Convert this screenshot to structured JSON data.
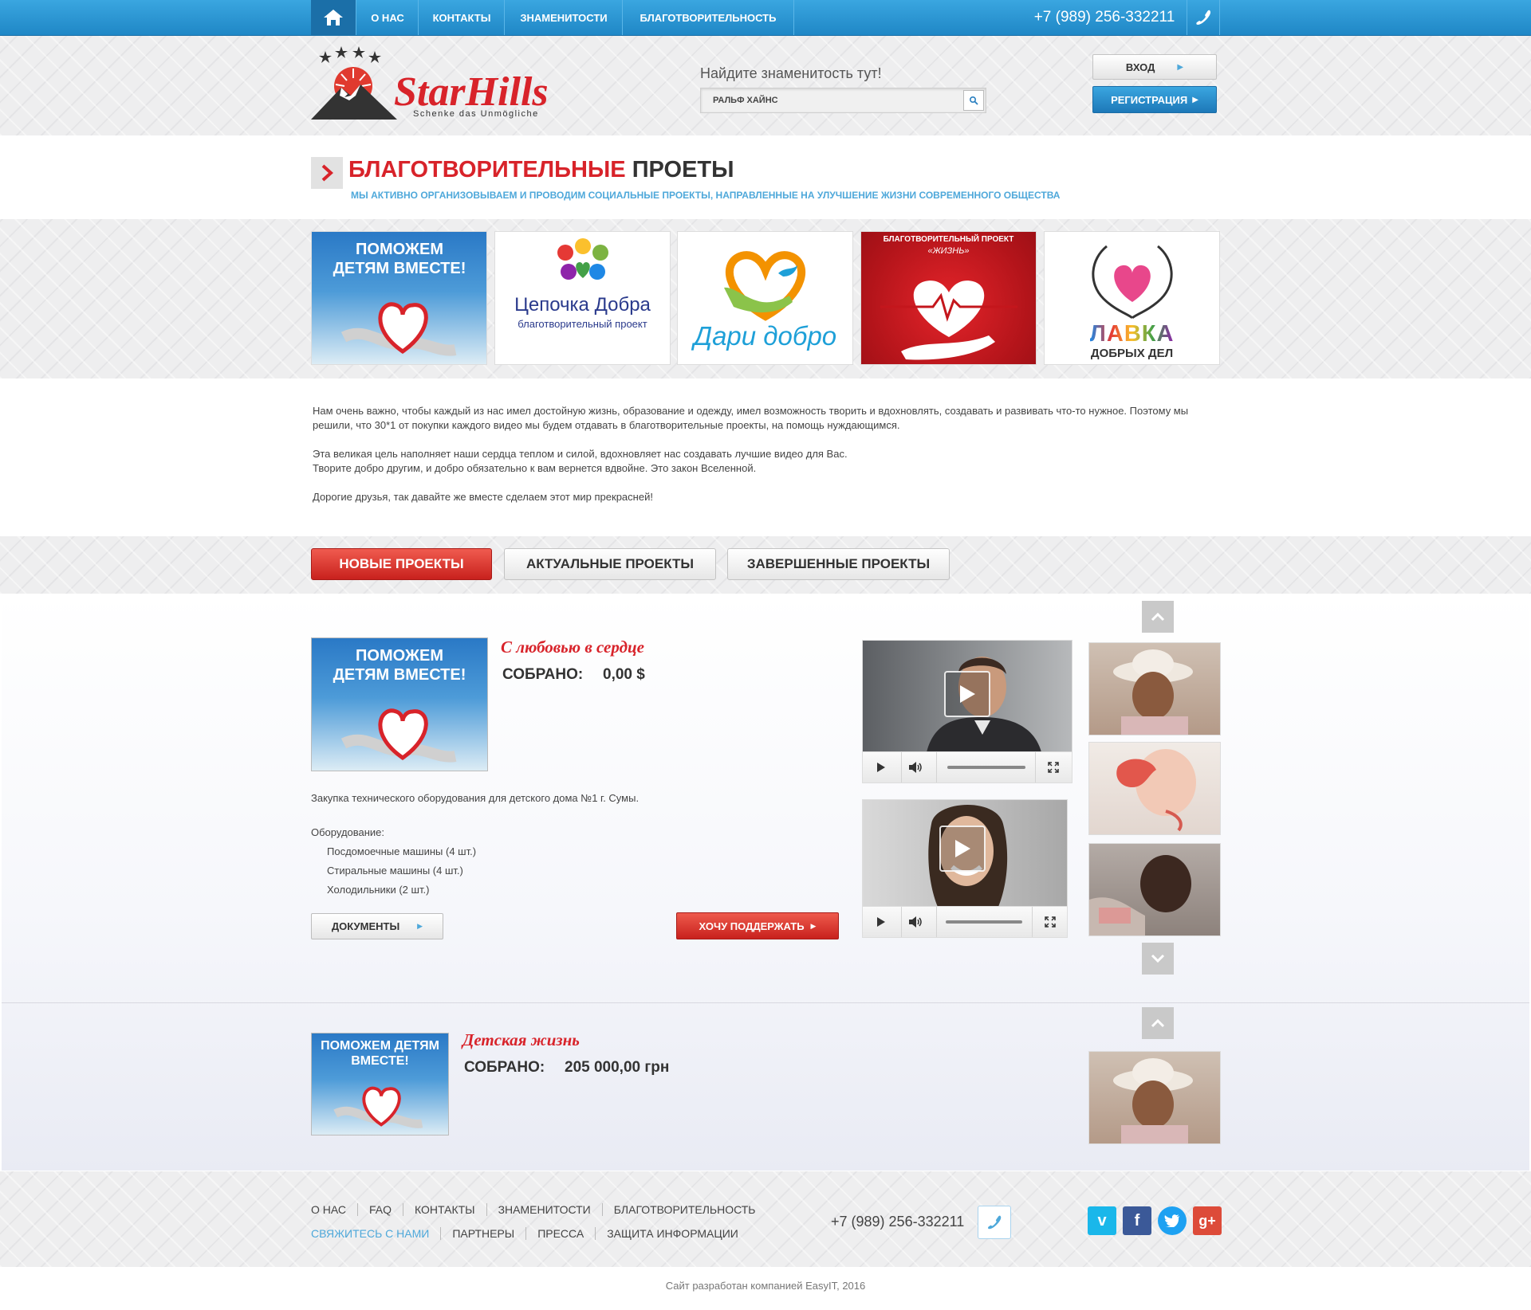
{
  "nav": {
    "items": [
      "О НАС",
      "КОНТАКТЫ",
      "ЗНАМЕНИТОСТИ",
      "БЛАГОТВОРИТЕЛЬНОСТЬ"
    ],
    "phone": "+7 (989) 256-332211"
  },
  "header": {
    "logo_name": "StarHills",
    "logo_tagline": "Schenke das Unmögliche",
    "search_label": "Найдите знаменитость тут!",
    "search_value": "РАЛЬФ ХАЙНС",
    "login_label": "ВХОД",
    "register_label": "РЕГИСТРАЦИЯ"
  },
  "page": {
    "title_red": "БЛАГОТВОРИТЕЛЬНЫЕ",
    "title_dark": "ПРОЕТЫ",
    "subtitle": "МЫ АКТИВНО ОРГАНИЗОВЫВАЕМ И ПРОВОДИМ СОЦИАЛЬНЫЕ ПРОЕКТЫ, НАПРАВЛЕННЫЕ НА УЛУЧШЕНИЕ ЖИЗНИ СОВРЕМЕННОГО ОБЩЕСТВА"
  },
  "project_logos": {
    "pomozhem": "ПОМОЖЕМ ДЕТЯМ ВМЕСТЕ!",
    "cepochka_title": "Цепочка Добра",
    "cepochka_sub": "благотворительный проект",
    "dari": "Дари добро",
    "zhizn_title": "БЛАГОТВОРИТЕЛЬНЫЙ ПРОЕКТ",
    "zhizn_sub": "«ЖИЗНЬ»",
    "lavka_title": "ЛАВКА",
    "lavka_sub": "ДОБРЫХ ДЕЛ"
  },
  "intro": {
    "p1": "Нам очень важно, чтобы каждый из нас имел достойную жизнь, образование и одежду, имел возможность творить и вдохновлять, создавать и развивать что-то нужное. Поэтому мы решили, что 30*1 от покупки каждого видео мы будем отдавать в благотворительные проекты, на помощь нуждающимся.",
    "p2a": "Эта великая цель наполняет наши сердца теплом и силой, вдохновляет нас создавать лучшие видео для Вас.",
    "p2b": "Творите добро другим, и добро обязательно к вам вернется вдвойне. Это закон Вселенной.",
    "p3": "Дорогие друзья, так давайте же вместе сделаем этот мир прекрасней!"
  },
  "tabs": [
    "НОВЫЕ ПРОЕКТЫ",
    "АКТУАЛЬНЫЕ ПРОЕКТЫ",
    "ЗАВЕРШЕННЫЕ ПРОЕКТЫ"
  ],
  "project1": {
    "image_text": "ПОМОЖЕМ ДЕТЯМ ВМЕСТЕ!",
    "title": "С любовью в сердце",
    "collected_label": "СОБРАНО:",
    "collected_value": "0,00 $",
    "description": "Закупка технического оборудования для детского дома №1 г. Сумы.",
    "equipment_label": "Оборудование:",
    "equipment": [
      "Посдомоечные машины (4 шт.)",
      "Стиральные машины (4 шт.)",
      "Холодильники (2 шт.)"
    ],
    "docs_label": "ДОКУМЕНТЫ",
    "support_label": "ХОЧУ ПОДДЕРЖАТЬ"
  },
  "project2": {
    "image_text": "ПОМОЖЕМ ДЕТЯМ ВМЕСТЕ!",
    "title": "Детская жизнь",
    "collected_label": "СОБРАНО:",
    "collected_value": "205 000,00 грн"
  },
  "footer": {
    "row1": [
      "О НАС",
      "FAQ",
      "КОНТАКТЫ",
      "ЗНАМЕНИТОСТИ",
      "БЛАГОТВОРИТЕЛЬНОСТЬ"
    ],
    "row2": [
      "СВЯЖИТЕСЬ С НАМИ",
      "ПАРТНЕРЫ",
      "ПРЕССА",
      "ЗАЩИТА ИНФОРМАЦИИ"
    ],
    "phone": "+7 (989) 256-332211",
    "copyright": "Сайт разработан компанией EasyIT, 2016"
  },
  "colors": {
    "brand_red": "#d8232a",
    "brand_blue": "#1f87c6",
    "link_blue": "#4ea8da"
  },
  "icons": [
    "home-icon",
    "phone-icon",
    "search-icon",
    "play-icon",
    "volume-icon",
    "fullscreen-icon",
    "chevron-up-icon",
    "chevron-down-icon",
    "vimeo-icon",
    "facebook-icon",
    "twitter-icon",
    "google-plus-icon"
  ]
}
